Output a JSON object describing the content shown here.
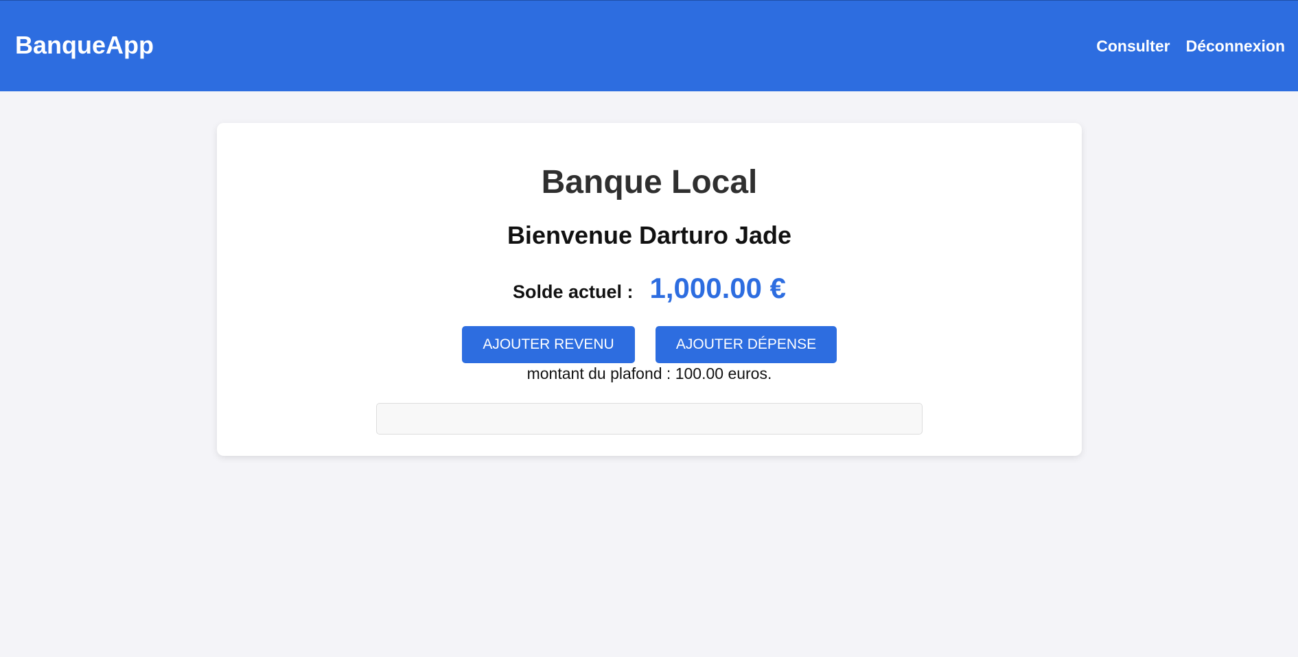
{
  "navbar": {
    "brand": "BanqueApp",
    "links": [
      "Consulter",
      "Déconnexion"
    ]
  },
  "main": {
    "title": "Banque Local",
    "welcome": "Bienvenue Darturo Jade",
    "balance_label": "Solde actuel :",
    "balance_value": "1,000.00 €",
    "buttons": {
      "add_revenue": "AJOUTER REVENU",
      "add_expense": "AJOUTER DÉPENSE"
    },
    "plafond_text": "montant du plafond : 100.00 euros.",
    "message": ""
  },
  "colors": {
    "primary": "#2d6de0",
    "background": "#f4f4f8",
    "card": "#ffffff"
  }
}
